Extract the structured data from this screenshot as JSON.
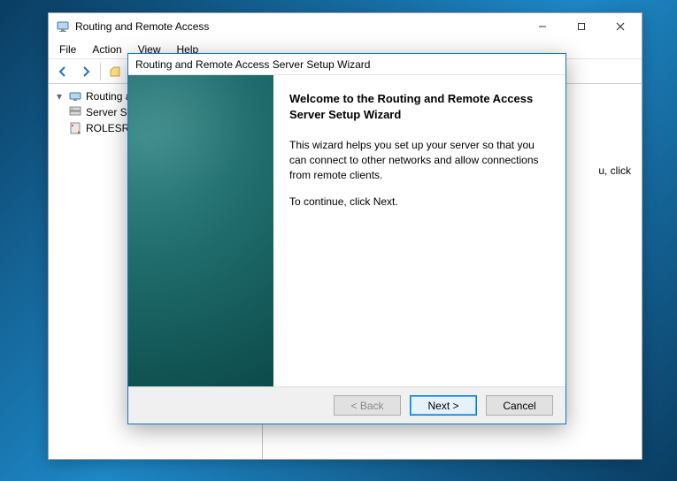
{
  "window": {
    "title": "Routing and Remote Access",
    "buttons": {
      "minimize": "–",
      "maximize": "□",
      "close": "✕"
    }
  },
  "menu": {
    "file": "File",
    "action": "Action",
    "view": "View",
    "help": "Help"
  },
  "toolbar": {
    "back": "back-icon",
    "forward": "forward-icon",
    "up": "up-icon",
    "refresh": "refresh-icon"
  },
  "tree": {
    "root": "Routing and",
    "node1": "Server St",
    "node2": "ROLESRV"
  },
  "content": {
    "fragment": "u, click"
  },
  "dialog": {
    "title": "Routing and Remote Access Server Setup Wizard",
    "heading": "Welcome to the Routing and Remote Access Server Setup Wizard",
    "para1": "This wizard helps you set up your server so that you can connect to other networks and allow connections from remote clients.",
    "para2": "To continue, click Next.",
    "buttons": {
      "back": "< Back",
      "next": "Next >",
      "cancel": "Cancel"
    }
  }
}
